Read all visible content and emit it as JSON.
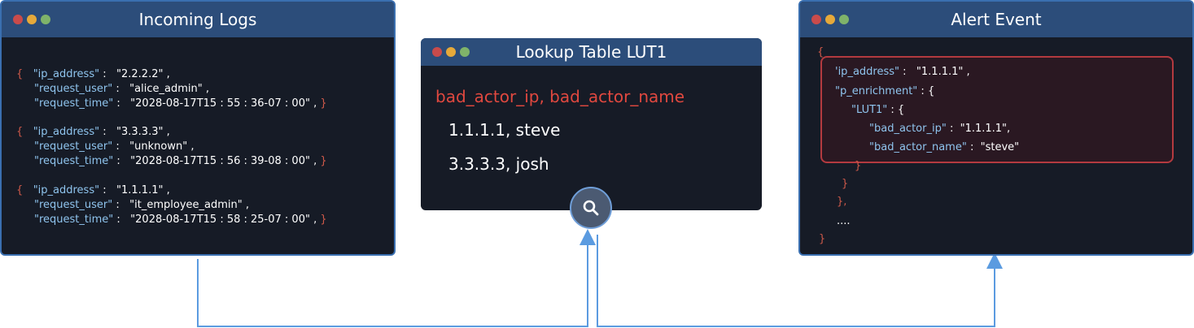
{
  "incoming": {
    "title": "Incoming Logs",
    "logs": [
      {
        "ip_key": "\"ip_address\"",
        "ip_val": "\"2.2.2.2\"",
        "user_key": "\"request_user\"",
        "user_val": "\"alice_admin\"",
        "time_key": "\"request_time\"",
        "time_val": "\"2028-08-17T15 : 55 : 36-07 : 00\""
      },
      {
        "ip_key": "\"ip_address\"",
        "ip_val": "\"3.3.3.3\"",
        "user_key": "\"request_user\"",
        "user_val": "\"unknown\"",
        "time_key": "\"request_time\"",
        "time_val": "\"2028-08-17T15 : 56 : 39-08 : 00\""
      },
      {
        "ip_key": "\"ip_address\"",
        "ip_val": "\"1.1.1.1\"",
        "user_key": "\"request_user\"",
        "user_val": "\"it_employee_admin\"",
        "time_key": "\"request_time\"",
        "time_val": "\"2028-08-17T15 : 58 : 25-07 : 00\""
      }
    ]
  },
  "lookup": {
    "title": "Lookup Table LUT1",
    "header": "bad_actor_ip, bad_actor_name",
    "rows": [
      "1.1.1.1, steve",
      "3.3.3.3, josh"
    ]
  },
  "alert": {
    "title": "Alert Event",
    "ip_key": "'ip_address\"",
    "ip_val": "\"1.1.1.1\"",
    "enrich_key": "\"p_enrichment\"",
    "lut_key": "\"LUT1\"",
    "bad_ip_key": "\"bad_actor_ip\"",
    "bad_ip_val": "\"1.1.1.1\"",
    "bad_name_key": "\"bad_actor_name\"",
    "bad_name_val": "\"steve\"",
    "ellipsis": "...."
  },
  "colors": {
    "connector": "#5b9be0",
    "highlight_border": "#b33a3f",
    "key_text": "#8fc4ee",
    "brace": "#d05a4a"
  },
  "icons": {
    "search": "magnifier-icon"
  }
}
